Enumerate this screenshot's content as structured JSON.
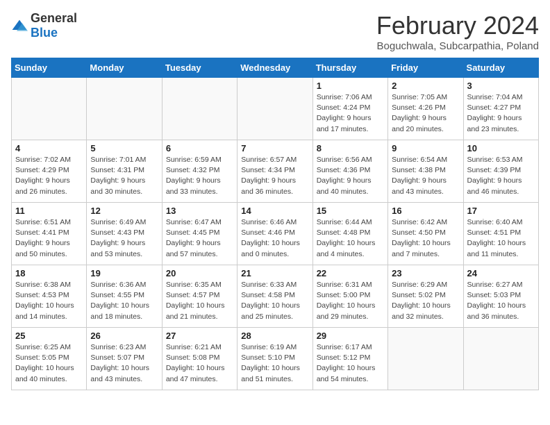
{
  "header": {
    "logo_general": "General",
    "logo_blue": "Blue",
    "month_title": "February 2024",
    "location": "Boguchwala, Subcarpathia, Poland"
  },
  "days_of_week": [
    "Sunday",
    "Monday",
    "Tuesday",
    "Wednesday",
    "Thursday",
    "Friday",
    "Saturday"
  ],
  "weeks": [
    [
      {
        "day": "",
        "info": ""
      },
      {
        "day": "",
        "info": ""
      },
      {
        "day": "",
        "info": ""
      },
      {
        "day": "",
        "info": ""
      },
      {
        "day": "1",
        "info": "Sunrise: 7:06 AM\nSunset: 4:24 PM\nDaylight: 9 hours\nand 17 minutes."
      },
      {
        "day": "2",
        "info": "Sunrise: 7:05 AM\nSunset: 4:26 PM\nDaylight: 9 hours\nand 20 minutes."
      },
      {
        "day": "3",
        "info": "Sunrise: 7:04 AM\nSunset: 4:27 PM\nDaylight: 9 hours\nand 23 minutes."
      }
    ],
    [
      {
        "day": "4",
        "info": "Sunrise: 7:02 AM\nSunset: 4:29 PM\nDaylight: 9 hours\nand 26 minutes."
      },
      {
        "day": "5",
        "info": "Sunrise: 7:01 AM\nSunset: 4:31 PM\nDaylight: 9 hours\nand 30 minutes."
      },
      {
        "day": "6",
        "info": "Sunrise: 6:59 AM\nSunset: 4:32 PM\nDaylight: 9 hours\nand 33 minutes."
      },
      {
        "day": "7",
        "info": "Sunrise: 6:57 AM\nSunset: 4:34 PM\nDaylight: 9 hours\nand 36 minutes."
      },
      {
        "day": "8",
        "info": "Sunrise: 6:56 AM\nSunset: 4:36 PM\nDaylight: 9 hours\nand 40 minutes."
      },
      {
        "day": "9",
        "info": "Sunrise: 6:54 AM\nSunset: 4:38 PM\nDaylight: 9 hours\nand 43 minutes."
      },
      {
        "day": "10",
        "info": "Sunrise: 6:53 AM\nSunset: 4:39 PM\nDaylight: 9 hours\nand 46 minutes."
      }
    ],
    [
      {
        "day": "11",
        "info": "Sunrise: 6:51 AM\nSunset: 4:41 PM\nDaylight: 9 hours\nand 50 minutes."
      },
      {
        "day": "12",
        "info": "Sunrise: 6:49 AM\nSunset: 4:43 PM\nDaylight: 9 hours\nand 53 minutes."
      },
      {
        "day": "13",
        "info": "Sunrise: 6:47 AM\nSunset: 4:45 PM\nDaylight: 9 hours\nand 57 minutes."
      },
      {
        "day": "14",
        "info": "Sunrise: 6:46 AM\nSunset: 4:46 PM\nDaylight: 10 hours\nand 0 minutes."
      },
      {
        "day": "15",
        "info": "Sunrise: 6:44 AM\nSunset: 4:48 PM\nDaylight: 10 hours\nand 4 minutes."
      },
      {
        "day": "16",
        "info": "Sunrise: 6:42 AM\nSunset: 4:50 PM\nDaylight: 10 hours\nand 7 minutes."
      },
      {
        "day": "17",
        "info": "Sunrise: 6:40 AM\nSunset: 4:51 PM\nDaylight: 10 hours\nand 11 minutes."
      }
    ],
    [
      {
        "day": "18",
        "info": "Sunrise: 6:38 AM\nSunset: 4:53 PM\nDaylight: 10 hours\nand 14 minutes."
      },
      {
        "day": "19",
        "info": "Sunrise: 6:36 AM\nSunset: 4:55 PM\nDaylight: 10 hours\nand 18 minutes."
      },
      {
        "day": "20",
        "info": "Sunrise: 6:35 AM\nSunset: 4:57 PM\nDaylight: 10 hours\nand 21 minutes."
      },
      {
        "day": "21",
        "info": "Sunrise: 6:33 AM\nSunset: 4:58 PM\nDaylight: 10 hours\nand 25 minutes."
      },
      {
        "day": "22",
        "info": "Sunrise: 6:31 AM\nSunset: 5:00 PM\nDaylight: 10 hours\nand 29 minutes."
      },
      {
        "day": "23",
        "info": "Sunrise: 6:29 AM\nSunset: 5:02 PM\nDaylight: 10 hours\nand 32 minutes."
      },
      {
        "day": "24",
        "info": "Sunrise: 6:27 AM\nSunset: 5:03 PM\nDaylight: 10 hours\nand 36 minutes."
      }
    ],
    [
      {
        "day": "25",
        "info": "Sunrise: 6:25 AM\nSunset: 5:05 PM\nDaylight: 10 hours\nand 40 minutes."
      },
      {
        "day": "26",
        "info": "Sunrise: 6:23 AM\nSunset: 5:07 PM\nDaylight: 10 hours\nand 43 minutes."
      },
      {
        "day": "27",
        "info": "Sunrise: 6:21 AM\nSunset: 5:08 PM\nDaylight: 10 hours\nand 47 minutes."
      },
      {
        "day": "28",
        "info": "Sunrise: 6:19 AM\nSunset: 5:10 PM\nDaylight: 10 hours\nand 51 minutes."
      },
      {
        "day": "29",
        "info": "Sunrise: 6:17 AM\nSunset: 5:12 PM\nDaylight: 10 hours\nand 54 minutes."
      },
      {
        "day": "",
        "info": ""
      },
      {
        "day": "",
        "info": ""
      }
    ]
  ]
}
